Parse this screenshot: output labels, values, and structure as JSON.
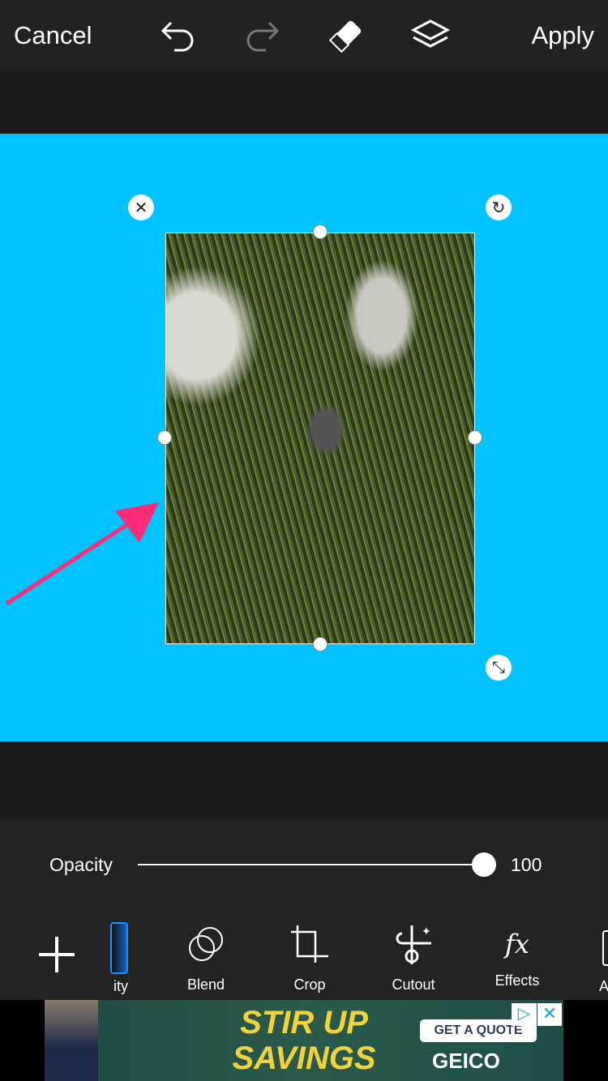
{
  "topbar": {
    "cancel": "Cancel",
    "apply": "Apply"
  },
  "canvas": {
    "background_color": "#00c3ff",
    "annotation_arrow_color": "#ff2d78"
  },
  "opacity": {
    "label": "Opacity",
    "value": "100",
    "level": 100
  },
  "tools": [
    {
      "label": "ity",
      "icon": "opacity-icon"
    },
    {
      "label": "Blend",
      "icon": "blend-icon"
    },
    {
      "label": "Crop",
      "icon": "crop-icon"
    },
    {
      "label": "Cutout",
      "icon": "cutout-icon"
    },
    {
      "label": "Effects",
      "icon": "fx-icon"
    },
    {
      "label": "A",
      "icon": "adjust-icon"
    }
  ],
  "ad": {
    "headline": "STIR UP SAVINGS",
    "cta": "GET A QUOTE",
    "brand": "GEICO"
  }
}
